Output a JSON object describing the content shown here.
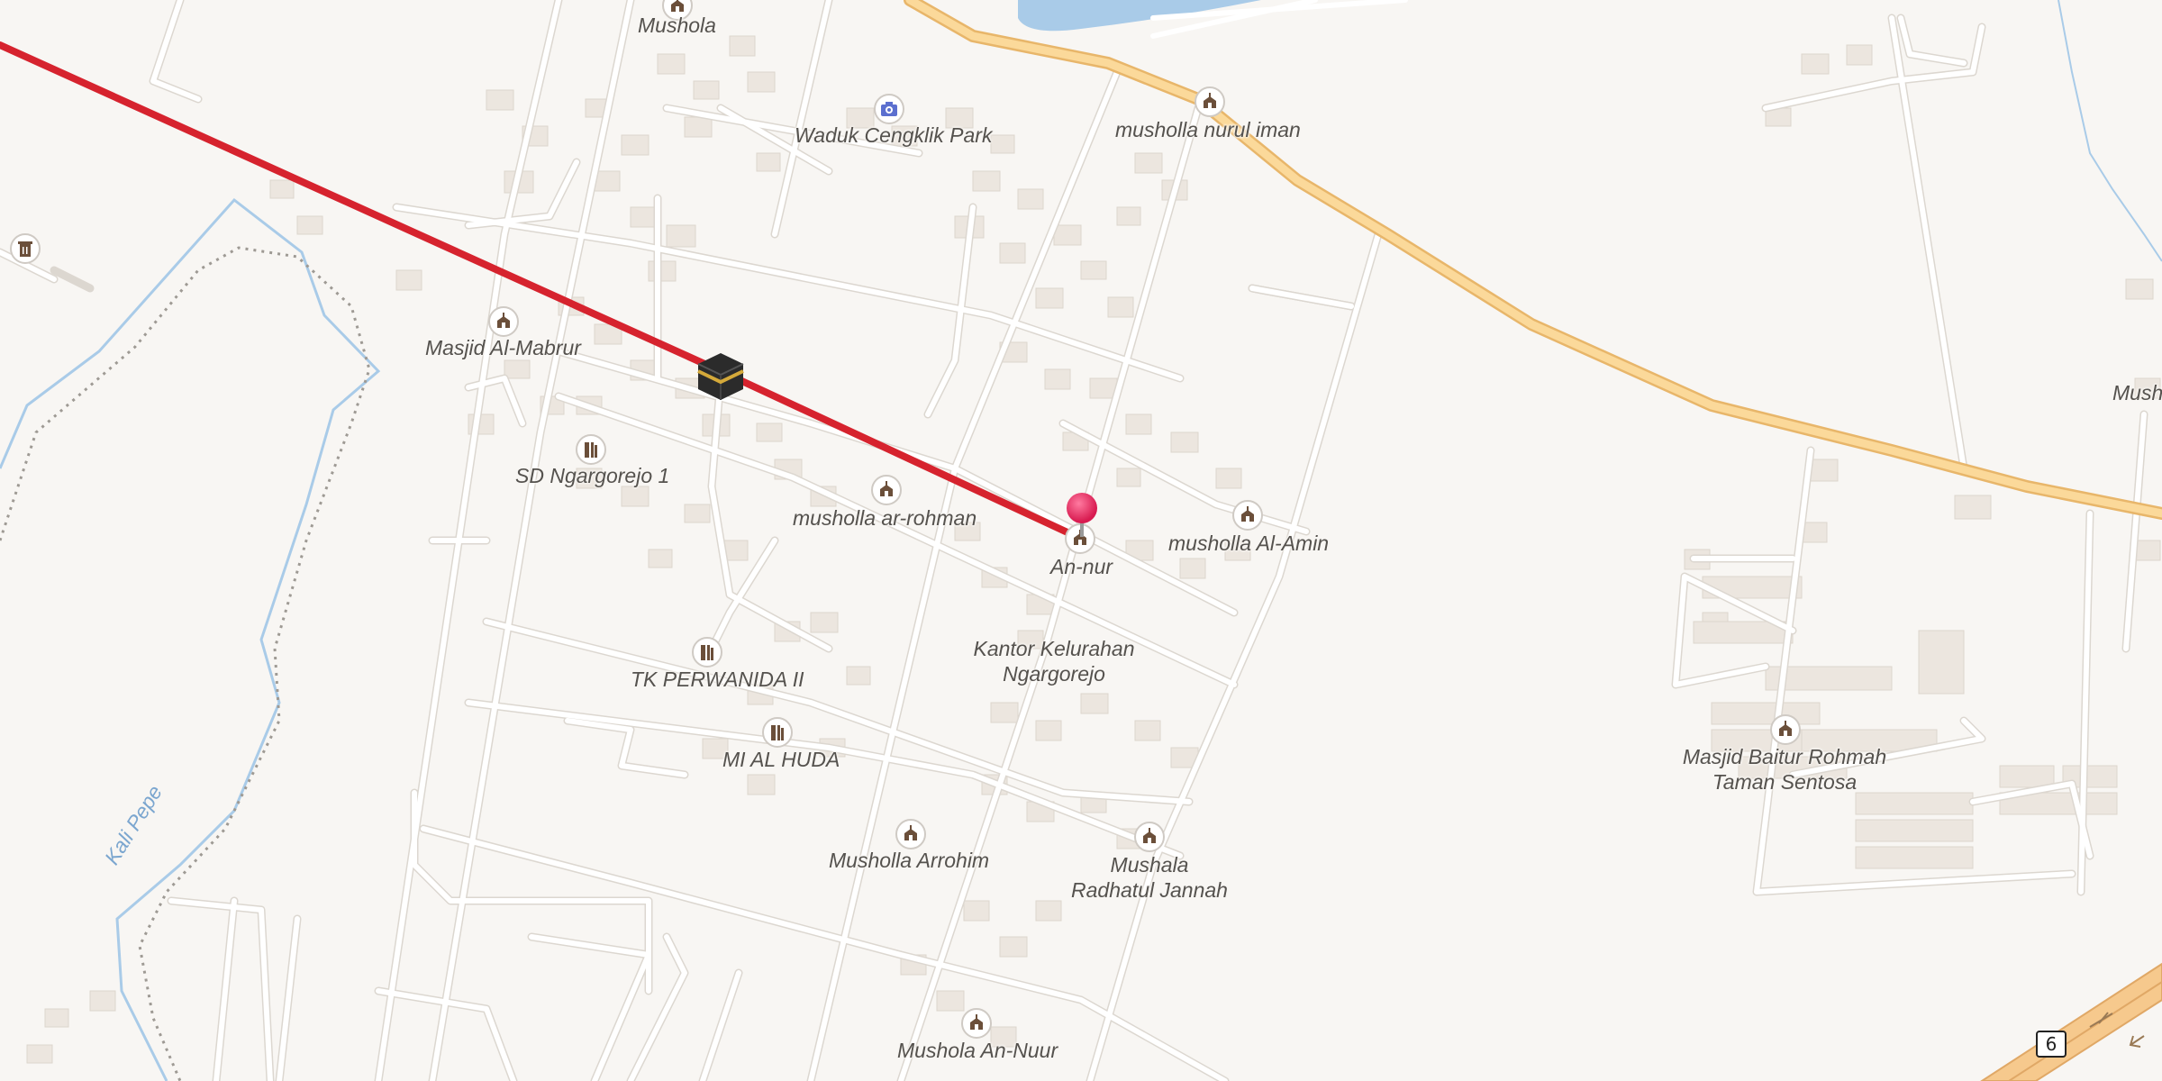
{
  "map": {
    "colors": {
      "background": "#f8f6f3",
      "road": "#ffffff",
      "road_casing": "#dcd7d0",
      "primary_road": "#fbd99a",
      "primary_casing": "#e8b66a",
      "motorway": "#f6c98d",
      "building": "#ece6df",
      "building_edge": "#ddd5cc",
      "water": "#a9cbe8",
      "route_line": "#d6232e",
      "marker": "#e8285c"
    },
    "icons": {
      "place_of_worship": "mosque-icon",
      "school": "school-icon",
      "viewpoint": "camera-icon",
      "waste": "waste-basket-icon",
      "destination": "kaaba-icon",
      "selected": "location-marker-icon"
    },
    "labels": {
      "mushola_top": "Mushola",
      "waduk": "Waduk Cengklik Park",
      "nurul_iman": "musholla nurul iman",
      "mabrur": "Masjid Al-Mabrur",
      "sd_ngargorejo": "SD Ngargorejo 1",
      "ar_rohman": "musholla ar-rohman",
      "an_nur": "An-nur",
      "al_amin": "musholla Al-Amin",
      "kantor_line1": "Kantor Kelurahan",
      "kantor_line2": "Ngargorejo",
      "tk_perwanida": "TK PERWANIDA II",
      "mi_al_huda": "MI AL HUDA",
      "arrohim": "Musholla Arrohim",
      "radhatul_line1": "Mushala",
      "radhatul_line2": "Radhatul Jannah",
      "baitur_line1": "Masjid Baitur Rohmah",
      "baitur_line2": "Taman Sentosa",
      "an_nuur": "Mushola An-Nuur",
      "mush_edge": "Mush",
      "kali_pepe": "Kali Pepe"
    },
    "road_shield": "6"
  }
}
